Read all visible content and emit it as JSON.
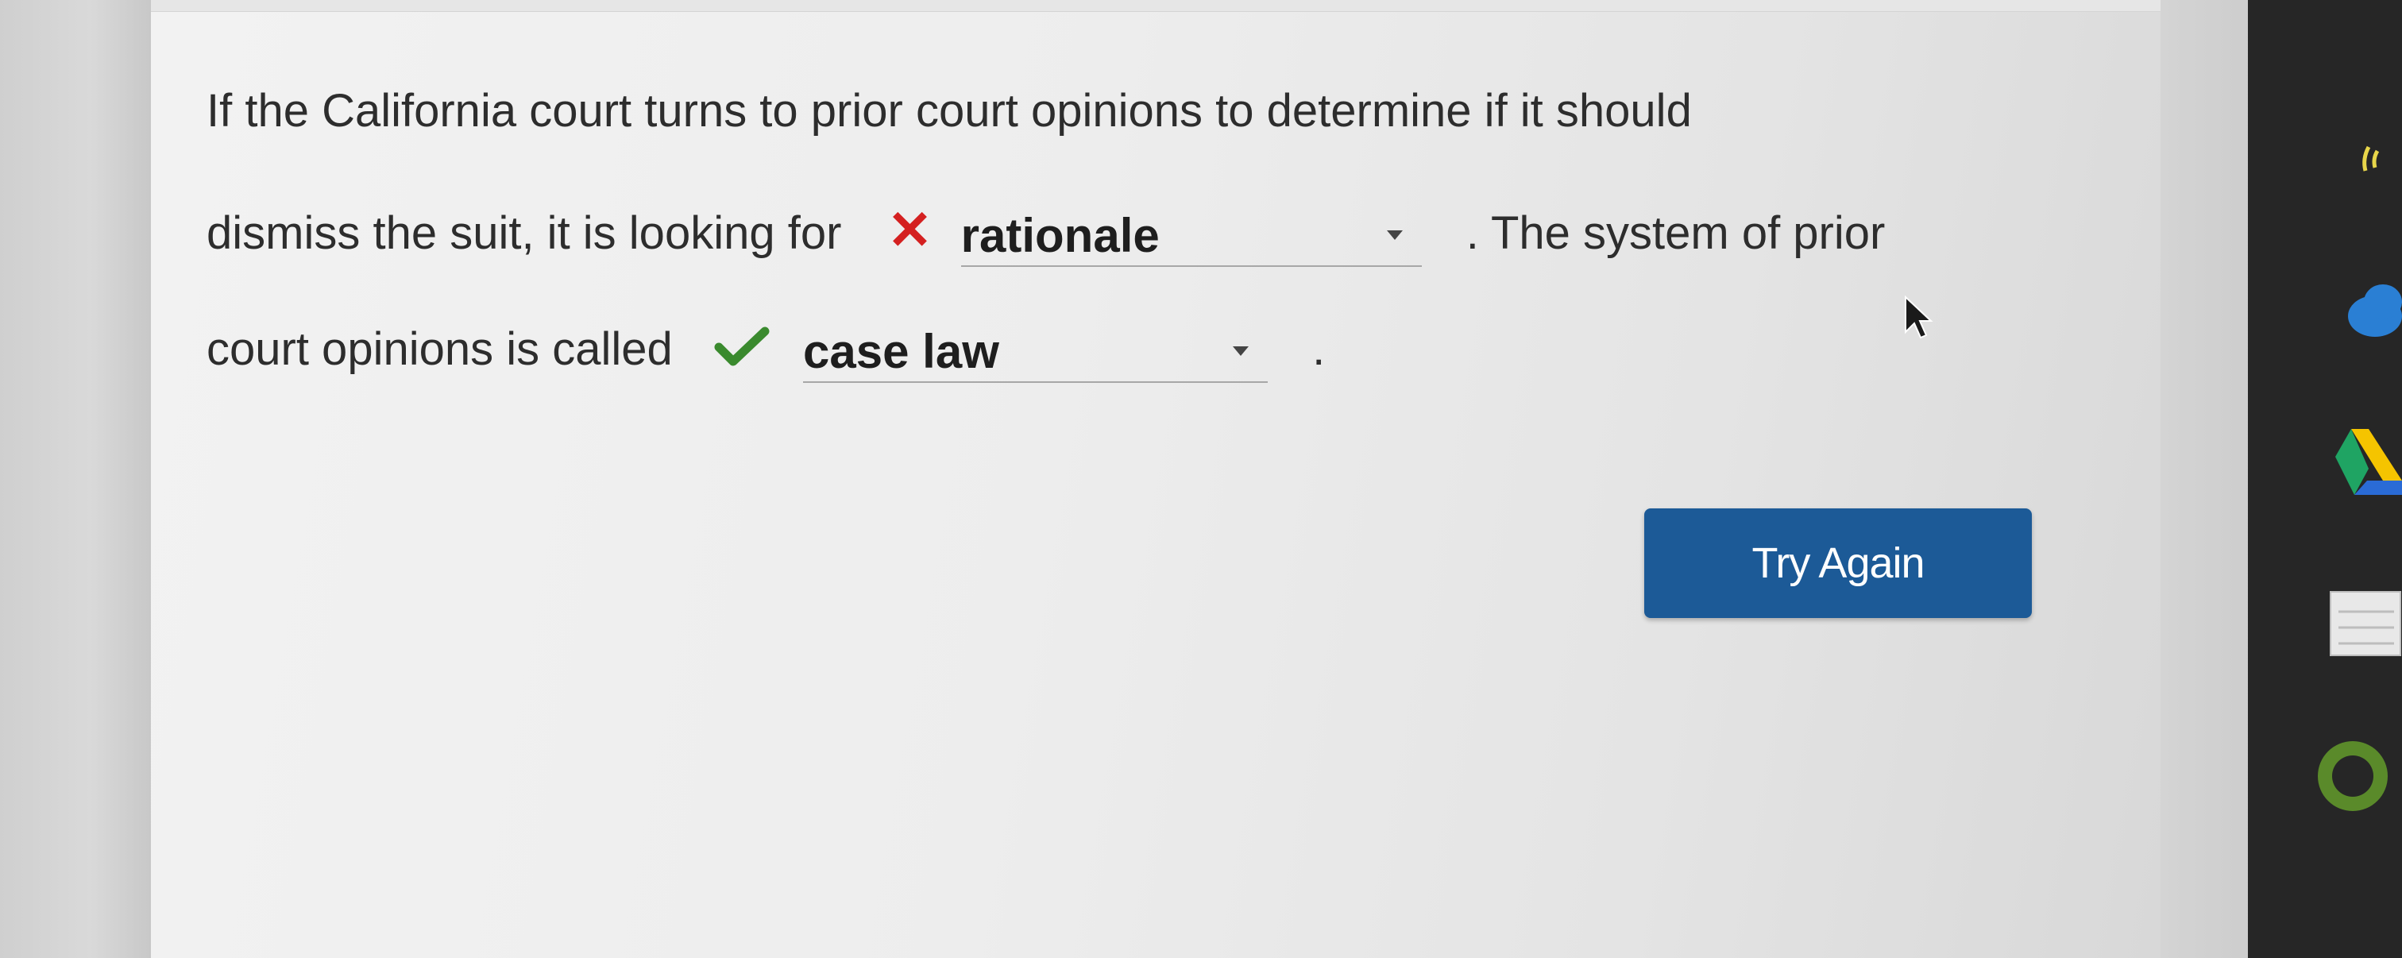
{
  "question": {
    "line1": "If the California court turns to prior court opinions to determine if it should",
    "line2_before": "dismiss the suit, it is looking for",
    "line2_after": ". The system of prior",
    "line3_before": "court opinions is called",
    "line3_after": "."
  },
  "blank1": {
    "selected": "rationale",
    "status": "incorrect",
    "status_color": "#d42020"
  },
  "blank2": {
    "selected": "case law",
    "status": "correct",
    "status_color": "#3a8a2e"
  },
  "actions": {
    "try_again_label": "Try Again",
    "button_color": "#1c5a97"
  },
  "dock": {
    "icons": [
      "wifi-icon",
      "cloud-icon",
      "google-drive-icon",
      "notes-icon",
      "circle-app-icon"
    ]
  }
}
